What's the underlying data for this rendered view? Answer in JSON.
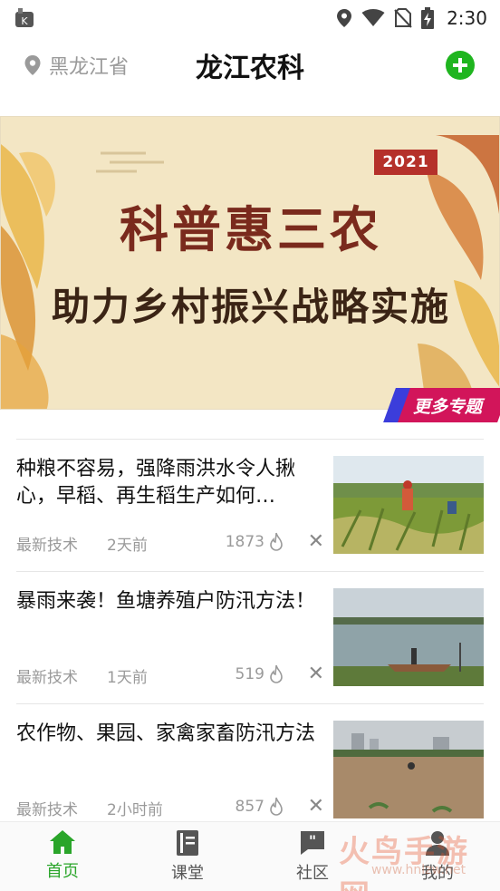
{
  "status_bar": {
    "time": "2:30",
    "icons": [
      "app-icon",
      "location-icon",
      "wifi-icon",
      "no-sim-icon",
      "battery-charging-icon"
    ]
  },
  "header": {
    "location": "黑龙江省",
    "title": "龙江农科",
    "add_icon": "plus-circle-icon"
  },
  "banner": {
    "year": "2021",
    "headline_main": "科普惠三农",
    "headline_sub": "助力乡村振兴战略实施",
    "more_label": "更多专题"
  },
  "news": [
    {
      "title": "种粮不容易，强降雨洪水令人揪心，早稻、再生稻生产如何…",
      "category": "最新技术",
      "time": "2天前",
      "views": "1873"
    },
    {
      "title": "暴雨来袭！鱼塘养殖户防汛方法！",
      "category": "最新技术",
      "time": "1天前",
      "views": "519"
    },
    {
      "title": "农作物、果园、家禽家畜防汛方法",
      "category": "最新技术",
      "time": "2小时前",
      "views": "857"
    }
  ],
  "bottom_nav": [
    {
      "label": "首页",
      "icon": "home-icon",
      "active": true
    },
    {
      "label": "课堂",
      "icon": "book-icon",
      "active": false
    },
    {
      "label": "社区",
      "icon": "chat-quote-icon",
      "active": false
    },
    {
      "label": "我的",
      "icon": "user-icon",
      "active": false
    }
  ],
  "watermark": {
    "text": "火鸟手游网",
    "sub": "www.hnlzw.net"
  },
  "colors": {
    "accent": "#2aa52a",
    "add_button": "#1fb51f",
    "banner_red": "#b5312a",
    "more_tag": "#d2155a"
  }
}
